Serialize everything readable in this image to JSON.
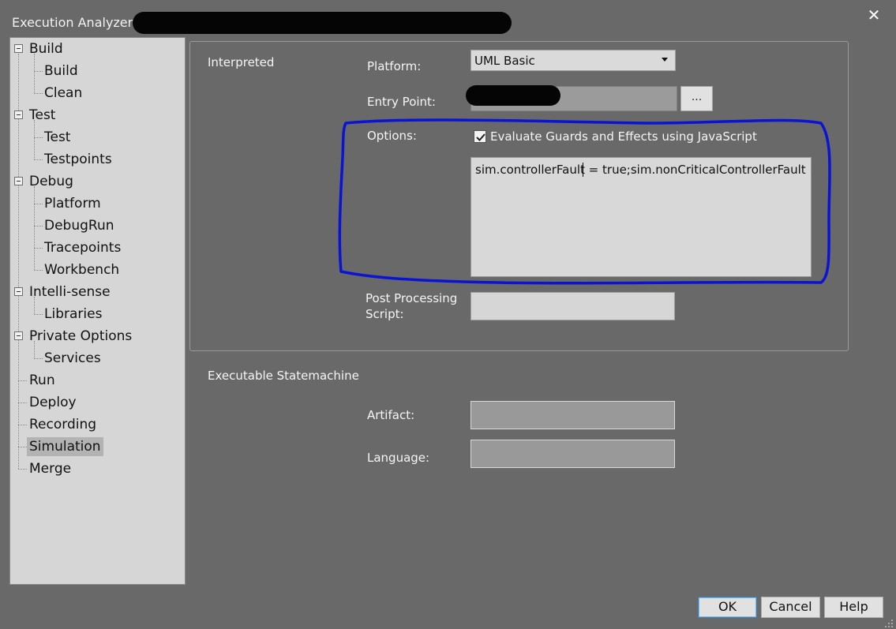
{
  "window": {
    "title": "Execution Analyzer:",
    "close_glyph": "✕"
  },
  "tree": [
    {
      "label": "Build",
      "level": 0,
      "expander": true
    },
    {
      "label": "Build",
      "level": 1
    },
    {
      "label": "Clean",
      "level": 1
    },
    {
      "label": "Test",
      "level": 0,
      "expander": true
    },
    {
      "label": "Test",
      "level": 1
    },
    {
      "label": "Testpoints",
      "level": 1
    },
    {
      "label": "Debug",
      "level": 0,
      "expander": true
    },
    {
      "label": "Platform",
      "level": 1
    },
    {
      "label": "DebugRun",
      "level": 1
    },
    {
      "label": "Tracepoints",
      "level": 1
    },
    {
      "label": "Workbench",
      "level": 1
    },
    {
      "label": "Intelli-sense",
      "level": 0,
      "expander": true
    },
    {
      "label": "Libraries",
      "level": 1
    },
    {
      "label": "Private Options",
      "level": 0,
      "expander": true
    },
    {
      "label": "Services",
      "level": 1
    },
    {
      "label": "Run",
      "level": 0
    },
    {
      "label": "Deploy",
      "level": 0
    },
    {
      "label": "Recording",
      "level": 0
    },
    {
      "label": "Simulation",
      "level": 0,
      "selected": true
    },
    {
      "label": "Merge",
      "level": 0
    }
  ],
  "interpreted": {
    "section_label": "Interpreted",
    "platform_label": "Platform:",
    "platform_value": "UML Basic",
    "entry_point_label": "Entry Point:",
    "browse_label": "...",
    "options_label": "Options:",
    "evaluate_checkbox_label": "Evaluate Guards and Effects using JavaScript",
    "evaluate_checked": true,
    "script_text": "sim.controllerFault = true;sim.nonCriticalControllerFault = '",
    "post_processing_label_line1": "Post Processing",
    "post_processing_label_line2": "Script:"
  },
  "executable": {
    "section_label": "Executable Statemachine",
    "artifact_label": "Artifact:",
    "language_label": "Language:"
  },
  "buttons": {
    "ok": "OK",
    "cancel": "Cancel",
    "help": "Help"
  },
  "colors": {
    "background": "#696969",
    "tree_background": "#d6d6d6",
    "selected_item": "#b3b3b3",
    "highlight_stroke": "#0a14d2"
  }
}
